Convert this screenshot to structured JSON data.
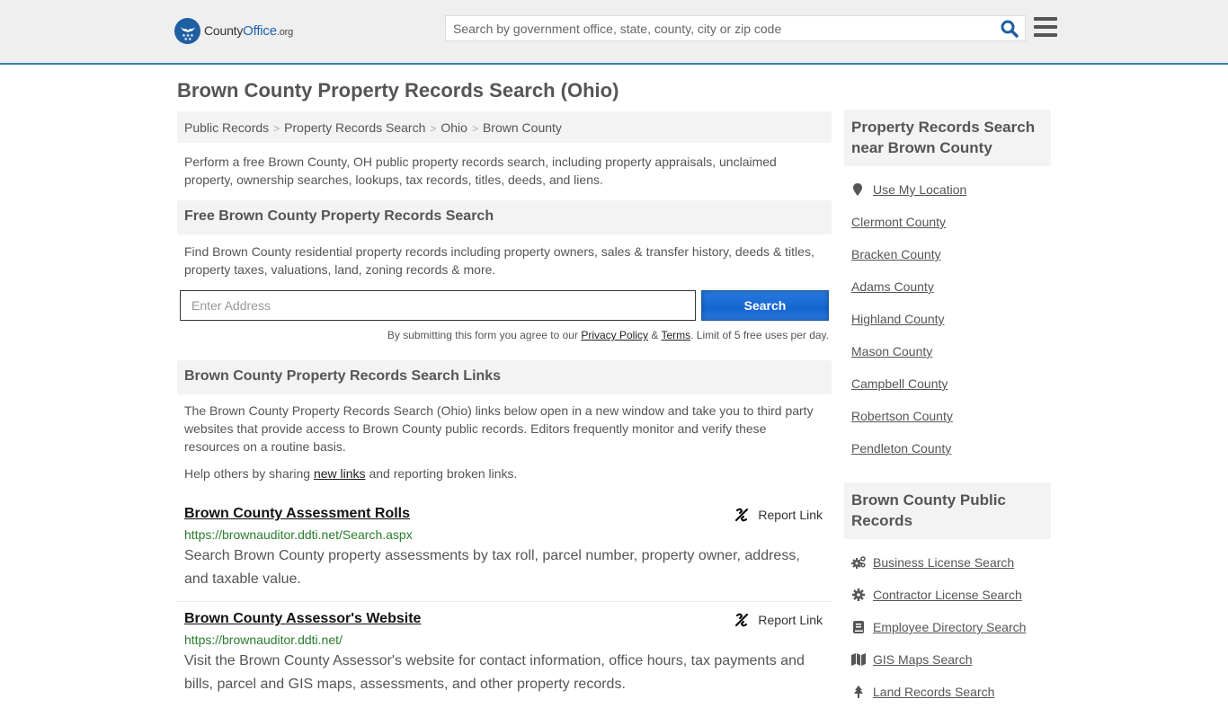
{
  "header": {
    "logo": {
      "name": "County",
      "office": "Office",
      "tld": ".org"
    },
    "search_placeholder": "Search by government office, state, county, city or zip code",
    "colors": {
      "brand": "#1e5fa2",
      "border": "#3a7cad"
    }
  },
  "page_title": "Brown County Property Records Search (Ohio)",
  "breadcrumb": [
    "Public Records",
    "Property Records Search",
    "Ohio",
    "Brown County"
  ],
  "intro": "Perform a free Brown County, OH public property records search, including property appraisals, unclaimed property, ownership searches, lookups, tax records, titles, deeds, and liens.",
  "free_search": {
    "heading": "Free Brown County Property Records Search",
    "description": "Find Brown County residential property records including property owners, sales & transfer history, deeds & titles, property taxes, valuations, land, zoning records & more.",
    "address_placeholder": "Enter Address",
    "button_label": "Search",
    "disclaimer_prefix": "By submitting this form you agree to our ",
    "privacy_label": "Privacy Policy",
    "amp": " & ",
    "terms_label": "Terms",
    "disclaimer_suffix": ". Limit of 5 free uses per day."
  },
  "links_section": {
    "heading": "Brown County Property Records Search Links",
    "description": "The Brown County Property Records Search (Ohio) links below open in a new window and take you to third party websites that provide access to Brown County public records. Editors frequently monitor and verify these resources on a routine basis.",
    "help_prefix": "Help others by sharing ",
    "help_link": "new links",
    "help_suffix": " and reporting broken links.",
    "report_label": "Report Link",
    "items": [
      {
        "title": "Brown County Assessment Rolls",
        "url": "https://brownauditor.ddti.net/Search.aspx",
        "description": "Search Brown County property assessments by tax roll, parcel number, property owner, address, and taxable value."
      },
      {
        "title": "Brown County Assessor's Website",
        "url": "https://brownauditor.ddti.net/",
        "description": "Visit the Brown County Assessor's website for contact information, office hours, tax payments and bills, parcel and GIS maps, assessments, and other property records."
      }
    ]
  },
  "sidebar": {
    "near_heading": "Property Records Search near Brown County",
    "use_location": "Use My Location",
    "nearby": [
      "Clermont County",
      "Bracken County",
      "Adams County",
      "Highland County",
      "Mason County",
      "Campbell County",
      "Robertson County",
      "Pendleton County"
    ],
    "public_heading": "Brown County Public Records",
    "public_records": [
      {
        "label": "Business License Search",
        "icon": "cogs-icon"
      },
      {
        "label": "Contractor License Search",
        "icon": "gear-icon"
      },
      {
        "label": "Employee Directory Search",
        "icon": "book-icon"
      },
      {
        "label": "GIS Maps Search",
        "icon": "map-icon"
      },
      {
        "label": "Land Records Search",
        "icon": "tree-icon"
      }
    ]
  }
}
